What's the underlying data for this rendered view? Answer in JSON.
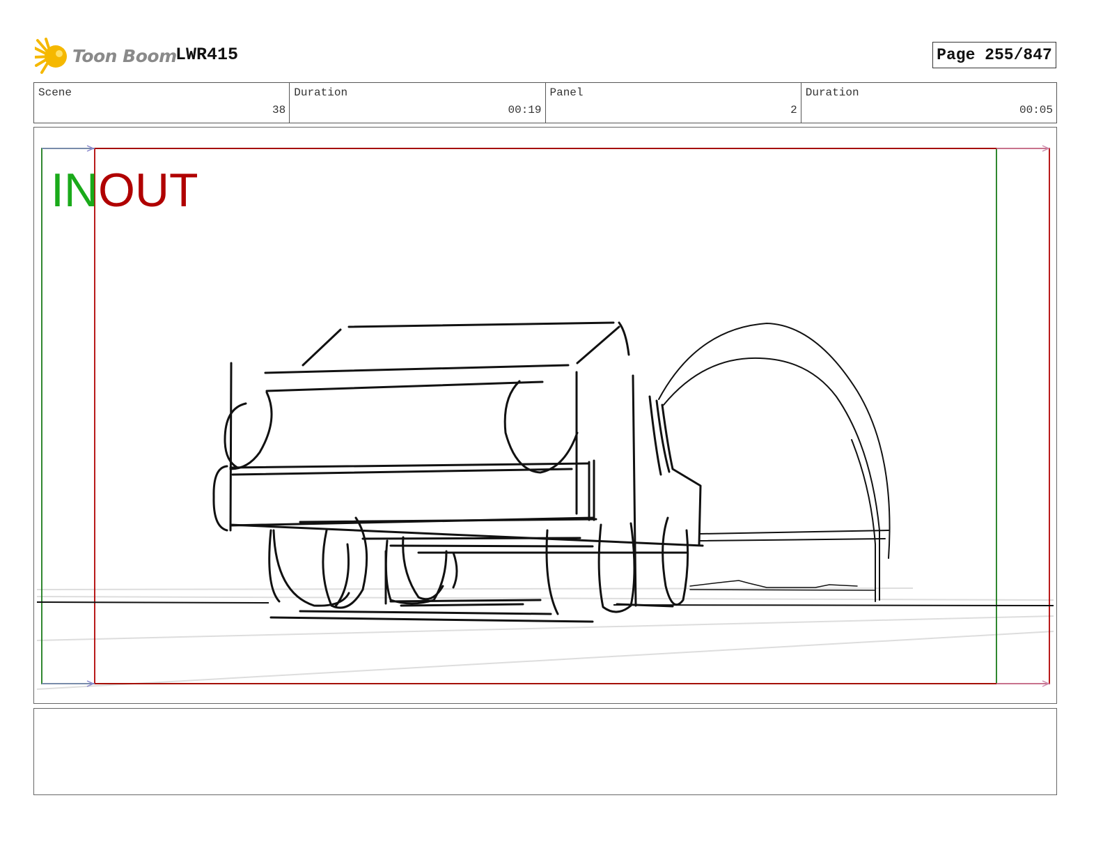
{
  "header": {
    "logo_text": "Toon Boom",
    "project_code": "LWR415",
    "page_label": "Page 255/847"
  },
  "info": {
    "scene_label": "Scene",
    "scene_value": "38",
    "scene_duration_label": "Duration",
    "scene_duration_value": "00:19",
    "panel_label": "Panel",
    "panel_value": "2",
    "panel_duration_label": "Duration",
    "panel_duration_value": "00:05"
  },
  "panel": {
    "in_label": "IN",
    "out_label": "OUT",
    "in_color": "#1aaa1a",
    "out_color": "#b00000"
  },
  "notes": {
    "text": ""
  }
}
